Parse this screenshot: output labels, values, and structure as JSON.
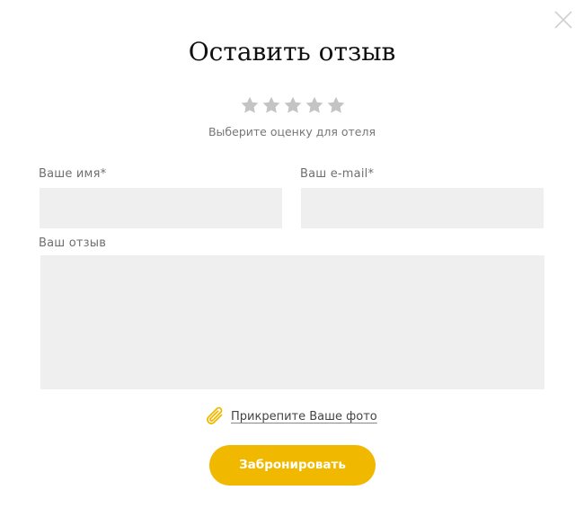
{
  "modal": {
    "title": "Оставить отзыв",
    "close_icon": "close-icon"
  },
  "rating": {
    "max_stars": 5,
    "selected": 0,
    "star_color": "#c4c4c4",
    "hint": "Выберите оценку для отеля"
  },
  "form": {
    "name_label": "Ваше имя*",
    "name_value": "",
    "email_label": "Ваш e-mail*",
    "email_value": "",
    "review_label": "Ваш отзыв",
    "review_value": "",
    "field_background": "#efefef"
  },
  "attach": {
    "icon": "paperclip-icon",
    "icon_color": "#f1b800",
    "label": "Прикрепите Ваше фото"
  },
  "submit": {
    "label": "Забронировать",
    "color": "#f1b800"
  }
}
